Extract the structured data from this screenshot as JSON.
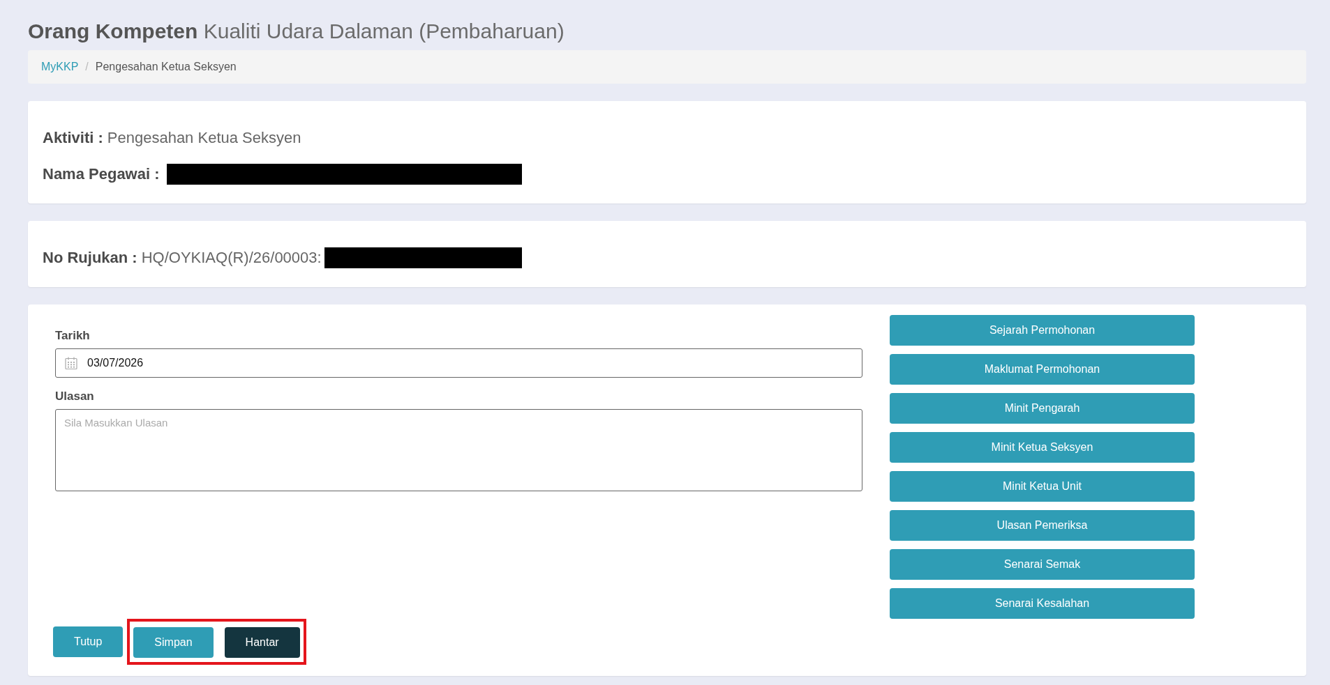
{
  "title": "**Orang Kompeten** Kualiti Udara Dalaman (Pembaharuan)",
  "breadcrumb": {
    "separator": "/",
    "items": [
      {
        "label": "MyKKP",
        "link": true
      },
      {
        "label": "Pengesahan Ketua Seksyen",
        "link": false
      }
    ]
  },
  "info_cards": [
    {
      "fields": [
        {
          "label": "Aktiviti :",
          "value": "Pengesahan Ketua Seksyen",
          "redacted": false
        },
        {
          "label": "Nama Pegawai :",
          "redacted": true
        }
      ]
    },
    {
      "fields": [
        {
          "label": "No Rujukan :",
          "value": "HQ/OYKIAQ(R)/26/00003:",
          "redacted": true
        }
      ]
    }
  ],
  "form": {
    "date": {
      "label": "Tarikh",
      "value": "03/07/2026"
    },
    "comment": {
      "label": "Ulasan",
      "placeholder": "Sila Masukkan Ulasan"
    }
  },
  "side_buttons": [
    "Sejarah Permohonan",
    "Maklumat Permohonan",
    "Minit Pengarah",
    "Minit Ketua Seksyen",
    "Minit Ketua Unit",
    "Ulasan Pemeriksa",
    "Senarai Semak",
    "Senarai Kesalahan"
  ],
  "actions": [
    {
      "label": "Tutup",
      "kind": "primary",
      "highlighted": false
    },
    {
      "label": "Simpan",
      "kind": "primary",
      "highlighted": true
    },
    {
      "label": "Hantar",
      "kind": "dark",
      "highlighted": true
    }
  ]
}
